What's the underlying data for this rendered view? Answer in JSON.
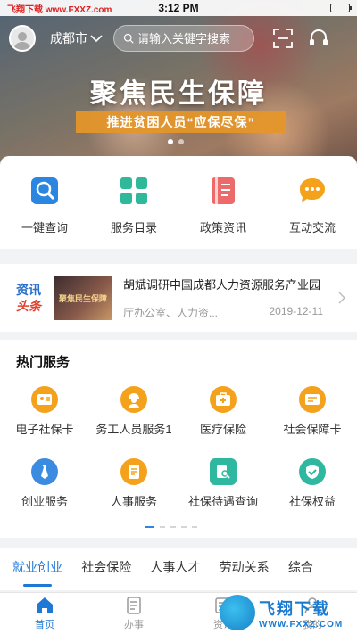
{
  "status_bar": {
    "watermark": "飞翔下载 www.FXXZ.com",
    "time": "3:12 PM",
    "battery_level": 1.0
  },
  "header": {
    "city": "成都市",
    "search_placeholder": "请输入关键字搜索"
  },
  "banner": {
    "title": "聚焦民生保障",
    "subtitle": "推进贫困人员“应保尽保”",
    "slide_count": 2,
    "active_slide": 1
  },
  "quick_entries": [
    {
      "label": "一键查询",
      "icon": "search-icon",
      "color": "#2a86e0"
    },
    {
      "label": "服务目录",
      "icon": "grid-icon",
      "color": "#2fb89a"
    },
    {
      "label": "政策资讯",
      "icon": "book-icon",
      "color": "#ec6a6a"
    },
    {
      "label": "互动交流",
      "icon": "chat-icon",
      "color": "#f4a21c"
    }
  ],
  "news": {
    "badge_top": "资讯",
    "badge_bottom": "头条",
    "thumb_text": "聚焦民生保障",
    "title": "胡斌调研中国成都人力资源服务产业园",
    "source": "厅办公室、人力资...",
    "date": "2019-12-11"
  },
  "hot_services": {
    "title": "热门服务",
    "items": [
      {
        "label": "电子社保卡",
        "icon": "id-card-icon"
      },
      {
        "label": "务工人员服务1",
        "icon": "worker-icon"
      },
      {
        "label": "医疗保险",
        "icon": "medical-kit-icon"
      },
      {
        "label": "社会保障卡",
        "icon": "social-card-icon"
      },
      {
        "label": "创业服务",
        "icon": "tie-icon"
      },
      {
        "label": "人事服务",
        "icon": "document-icon"
      },
      {
        "label": "社保待遇查询",
        "icon": "query-doc-icon"
      },
      {
        "label": "社保权益",
        "icon": "badge-check-icon"
      }
    ],
    "page_count": 5,
    "active_page": 1
  },
  "categories": [
    {
      "label": "就业创业",
      "active": true
    },
    {
      "label": "社会保险",
      "active": false
    },
    {
      "label": "人事人才",
      "active": false
    },
    {
      "label": "劳动关系",
      "active": false
    },
    {
      "label": "综合",
      "active": false
    }
  ],
  "tabbar": [
    {
      "label": "首页",
      "icon": "home-icon",
      "active": true
    },
    {
      "label": "办事",
      "icon": "task-icon",
      "active": false
    },
    {
      "label": "资讯",
      "icon": "news-icon",
      "active": false
    },
    {
      "label": "我的",
      "icon": "user-icon",
      "active": false
    }
  ],
  "corner_watermark": {
    "brand": "飞翔下载",
    "url": "WWW.FXXZ.COM"
  },
  "colors": {
    "accent": "#1e78d6",
    "service_yellow": "#f4a21c",
    "service_teal": "#2fb8a0"
  }
}
